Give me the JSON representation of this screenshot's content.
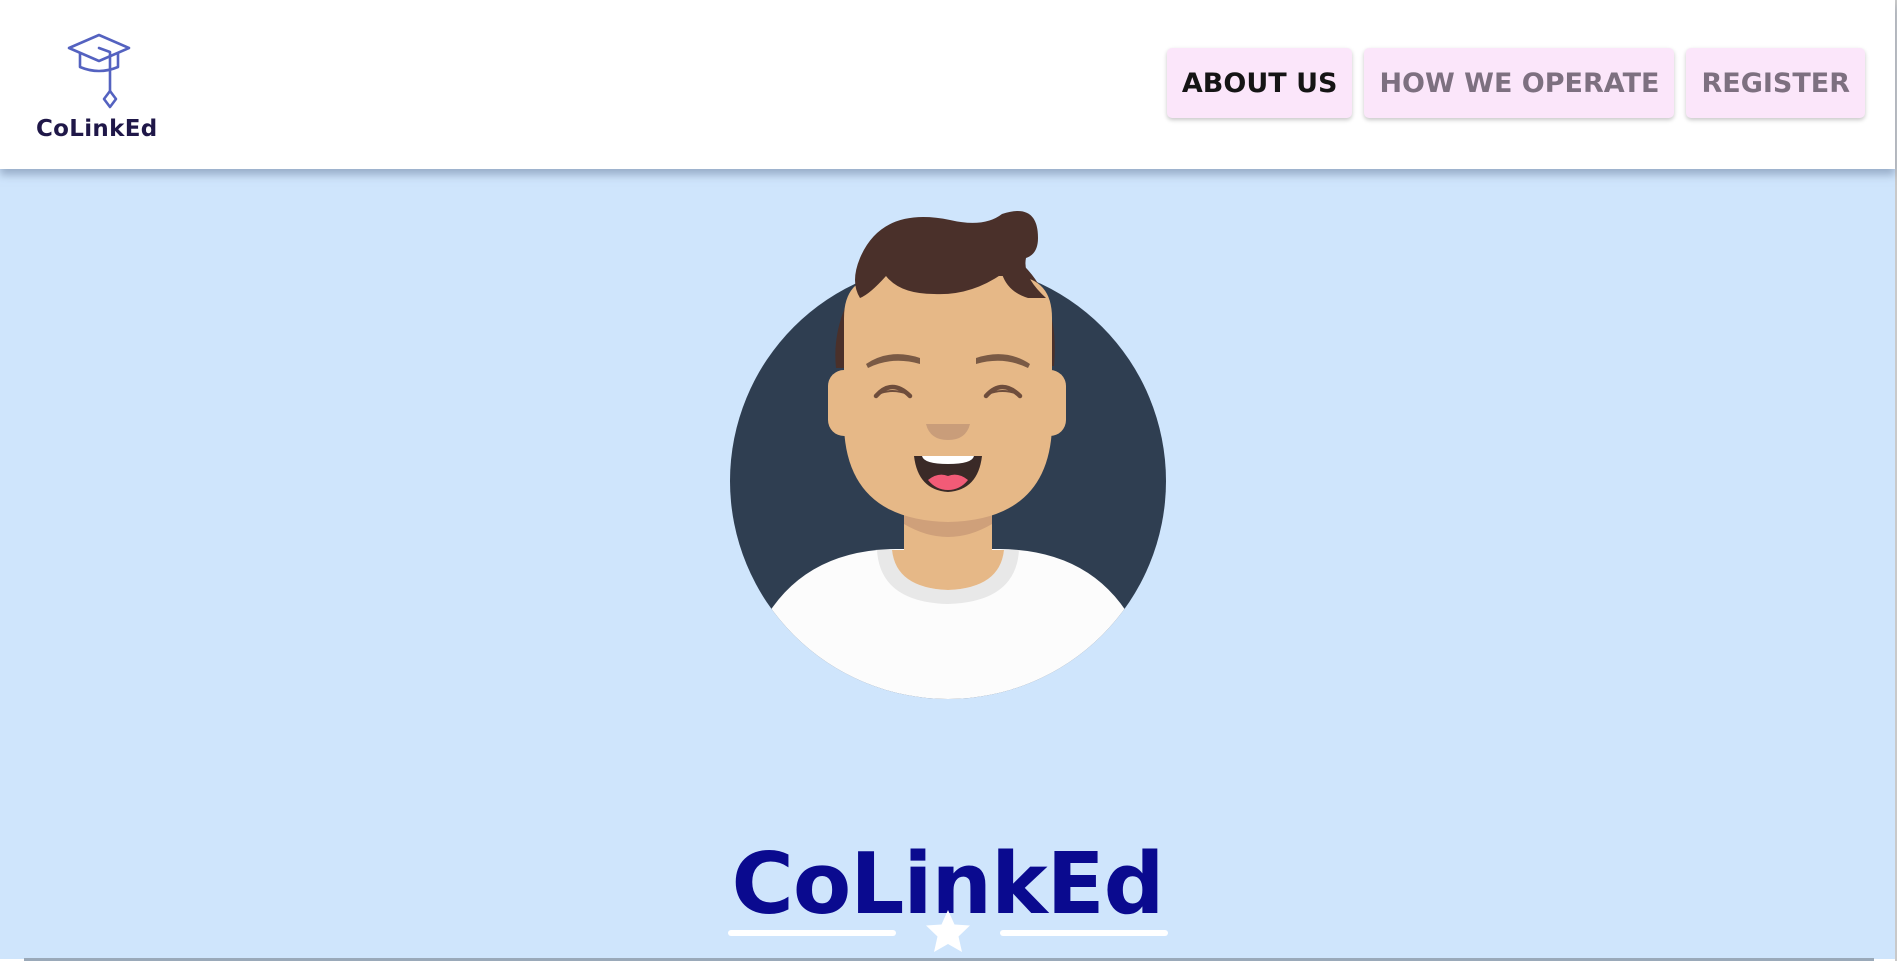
{
  "header": {
    "brand": {
      "name": "CoLinkEd",
      "icon": "graduation-cap-icon"
    },
    "nav": [
      {
        "label": "ABOUT US",
        "active": true
      },
      {
        "label": "HOW WE OPERATE",
        "active": false
      },
      {
        "label": "REGISTER",
        "active": false
      }
    ]
  },
  "hero": {
    "avatar": "smiling-man-avatar",
    "title": "CoLinkEd",
    "divider_icon": "star-icon"
  },
  "colors": {
    "hero_background": "#cfe5fc",
    "title": "#0a0a8f",
    "nav_button_background": "#fbe6fa",
    "nav_active_text": "#151515",
    "nav_inactive_text": "#7d7080",
    "avatar_circle": "#2f3e51",
    "brand_text": "#1f1748"
  }
}
